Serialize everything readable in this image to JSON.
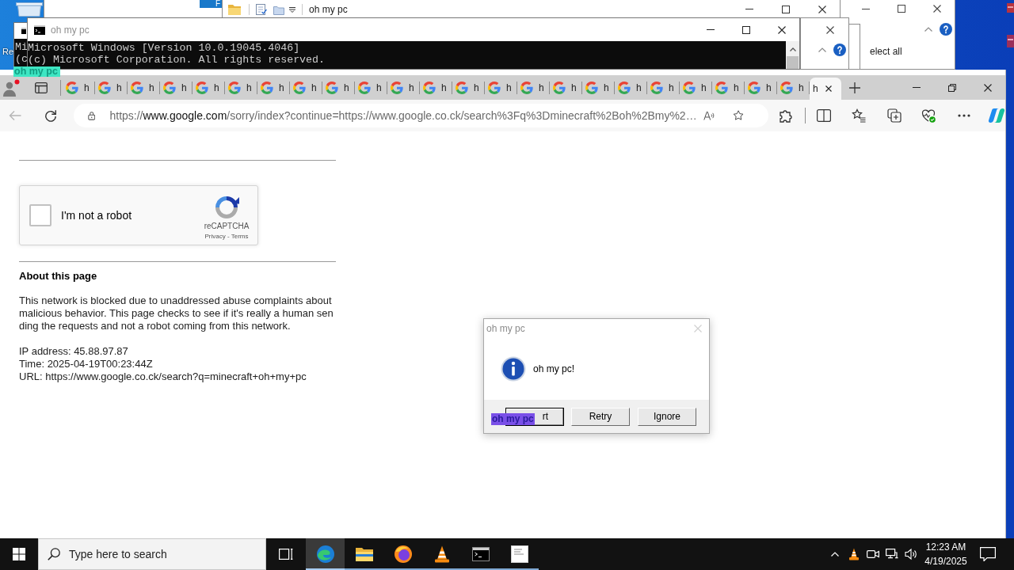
{
  "desktop": {
    "icon_label": "Re"
  },
  "back_window": {
    "ribbon_tab": "F"
  },
  "explorer_window": {
    "title": "oh my pc"
  },
  "side_window": {
    "ribbon_item": "elect all"
  },
  "back_console": {
    "lines": [
      "Mi",
      "(c"
    ]
  },
  "console": {
    "title": "oh my pc",
    "lines": [
      "Microsoft Windows [Version 10.0.19045.4046]",
      "(c) Microsoft Corporation. All rights reserved."
    ]
  },
  "browser": {
    "tabs": [
      {
        "title": "h",
        "selected": false
      },
      {
        "title": "h",
        "selected": false
      },
      {
        "title": "h",
        "selected": false
      },
      {
        "title": "h",
        "selected": false
      },
      {
        "title": "h",
        "selected": false
      },
      {
        "title": "h",
        "selected": false
      },
      {
        "title": "h",
        "selected": false
      },
      {
        "title": "h",
        "selected": false
      },
      {
        "title": "h",
        "selected": false
      },
      {
        "title": "h",
        "selected": false
      },
      {
        "title": "h",
        "selected": false
      },
      {
        "title": "h",
        "selected": false
      },
      {
        "title": "h",
        "selected": false
      },
      {
        "title": "h",
        "selected": false
      },
      {
        "title": "h",
        "selected": false
      },
      {
        "title": "h",
        "selected": false
      },
      {
        "title": "h",
        "selected": false
      },
      {
        "title": "h",
        "selected": false
      },
      {
        "title": "h",
        "selected": false
      },
      {
        "title": "h",
        "selected": false
      },
      {
        "title": "h",
        "selected": false
      },
      {
        "title": "h",
        "selected": false
      },
      {
        "title": "h",
        "selected": false
      },
      {
        "title": "h",
        "selected": true
      }
    ],
    "back_disabled": true,
    "address": {
      "scheme": "https://",
      "host": "www.google.com",
      "path": "/sorry/index?continue=https://www.google.co.ck/search%3Fq%3Dminecraft%2Boh%2Bmy%2…"
    },
    "page": {
      "captcha": {
        "label": "I'm not a robot",
        "checked": false,
        "brand": "reCAPTCHA",
        "links": "Privacy - Terms"
      },
      "heading": "About this page",
      "paragraph": "This network is blocked due to unaddressed abuse complaints about malicious behavior. This page checks to see if it's really a human sending the requests and not a robot coming from this network.",
      "details": [
        "IP address: 45.88.97.87",
        "Time: 2025-04-19T00:23:44Z",
        "URL: https://www.google.co.ck/search?q=minecraft+oh+my+pc"
      ]
    }
  },
  "dialog": {
    "title": "oh my pc",
    "message": "oh my pc!",
    "buttons": [
      {
        "label": "rt",
        "default": true
      },
      {
        "label": "Retry",
        "default": false
      },
      {
        "label": "Ignore",
        "default": false
      }
    ]
  },
  "labels": [
    {
      "text": "oh my pc",
      "color": "#3ee6c3"
    },
    {
      "text": "oh my pc",
      "color": "#7a50e8"
    }
  ],
  "taskbar": {
    "search": {
      "placeholder": "Type here to search"
    },
    "apps": [
      {
        "kind": "browser",
        "selected": true
      },
      {
        "kind": "files",
        "selected": false
      },
      {
        "kind": "fox",
        "selected": false
      },
      {
        "kind": "cone",
        "selected": false
      },
      {
        "kind": "terminal",
        "selected": false
      },
      {
        "kind": "notes",
        "selected": false
      }
    ],
    "clock": {
      "time": "12:23 AM",
      "date": "4/19/2025"
    }
  }
}
